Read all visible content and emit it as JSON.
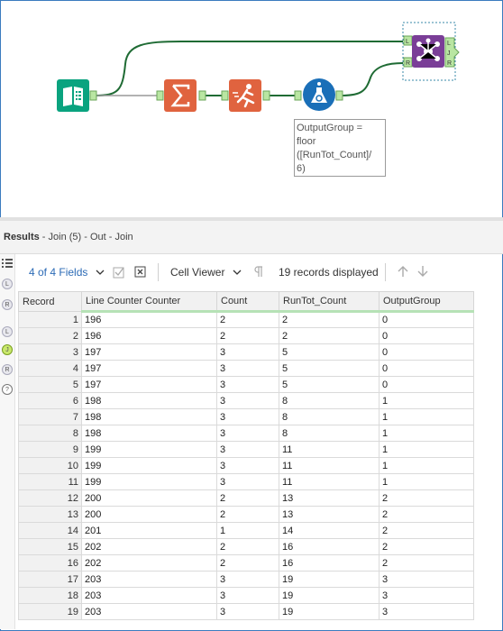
{
  "workflow": {
    "annotation_lines": [
      "OutputGroup =",
      "floor",
      "([RunTot_Count]/",
      "6)"
    ],
    "tools": [
      {
        "name": "input-data-tool",
        "icon": "book-icon",
        "color": "#0aa37f"
      },
      {
        "name": "summarize-tool",
        "icon": "sigma-icon",
        "color": "#e0633f"
      },
      {
        "name": "running-total-tool",
        "icon": "runner-icon",
        "color": "#e0633f"
      },
      {
        "name": "formula-tool",
        "icon": "flask-icon",
        "color": "#1a6fb8"
      },
      {
        "name": "join-tool",
        "icon": "join-icon",
        "color": "#7a3e97"
      }
    ],
    "join_anchors": {
      "left_in": "L",
      "right_in": "R",
      "left_out": "L",
      "join_out": "J",
      "right_out": "R"
    }
  },
  "results": {
    "title_bold": "Results",
    "title_rest": " - Join (5) - Out - Join",
    "sidebar_badges": [
      "L",
      "R",
      "L",
      "J",
      "R",
      "?"
    ],
    "toolbar": {
      "fields_label": "4 of 4 Fields",
      "viewer_label": "Cell Viewer",
      "records_label": "19 records displayed"
    },
    "columns": [
      "Record",
      "Line Counter Counter",
      "Count",
      "RunTot_Count",
      "OutputGroup"
    ],
    "rows": [
      [
        "1",
        "196",
        "2",
        "2",
        "0"
      ],
      [
        "2",
        "196",
        "2",
        "2",
        "0"
      ],
      [
        "3",
        "197",
        "3",
        "5",
        "0"
      ],
      [
        "4",
        "197",
        "3",
        "5",
        "0"
      ],
      [
        "5",
        "197",
        "3",
        "5",
        "0"
      ],
      [
        "6",
        "198",
        "3",
        "8",
        "1"
      ],
      [
        "7",
        "198",
        "3",
        "8",
        "1"
      ],
      [
        "8",
        "198",
        "3",
        "8",
        "1"
      ],
      [
        "9",
        "199",
        "3",
        "11",
        "1"
      ],
      [
        "10",
        "199",
        "3",
        "11",
        "1"
      ],
      [
        "11",
        "199",
        "3",
        "11",
        "1"
      ],
      [
        "12",
        "200",
        "2",
        "13",
        "2"
      ],
      [
        "13",
        "200",
        "2",
        "13",
        "2"
      ],
      [
        "14",
        "201",
        "1",
        "14",
        "2"
      ],
      [
        "15",
        "202",
        "2",
        "16",
        "2"
      ],
      [
        "16",
        "202",
        "2",
        "16",
        "2"
      ],
      [
        "17",
        "203",
        "3",
        "19",
        "3"
      ],
      [
        "18",
        "203",
        "3",
        "19",
        "3"
      ],
      [
        "19",
        "203",
        "3",
        "19",
        "3"
      ]
    ]
  }
}
